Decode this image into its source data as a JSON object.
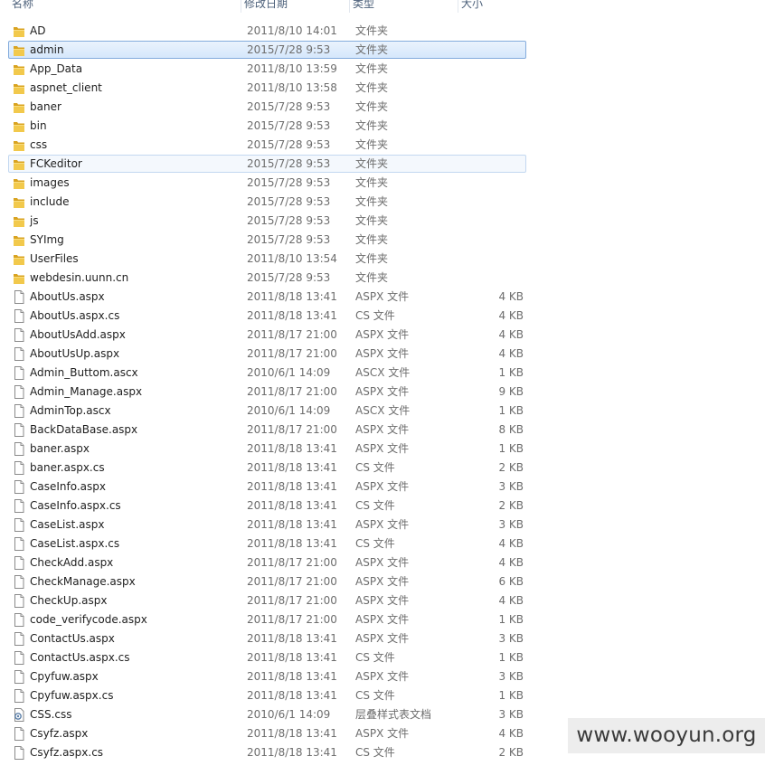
{
  "columns": {
    "name": "名称",
    "date": "修改日期",
    "type": "类型",
    "size": "大小"
  },
  "files": [
    {
      "name": "AD",
      "date": "2011/8/10 14:01",
      "type": "文件夹",
      "size": "",
      "icon": "folder-icon"
    },
    {
      "name": "admin",
      "date": "2015/7/28 9:53",
      "type": "文件夹",
      "size": "",
      "icon": "folder-icon",
      "state": "selected"
    },
    {
      "name": "App_Data",
      "date": "2011/8/10 13:59",
      "type": "文件夹",
      "size": "",
      "icon": "folder-icon"
    },
    {
      "name": "aspnet_client",
      "date": "2011/8/10 13:58",
      "type": "文件夹",
      "size": "",
      "icon": "folder-icon"
    },
    {
      "name": "baner",
      "date": "2015/7/28 9:53",
      "type": "文件夹",
      "size": "",
      "icon": "folder-icon"
    },
    {
      "name": "bin",
      "date": "2015/7/28 9:53",
      "type": "文件夹",
      "size": "",
      "icon": "folder-icon"
    },
    {
      "name": "css",
      "date": "2015/7/28 9:53",
      "type": "文件夹",
      "size": "",
      "icon": "folder-icon"
    },
    {
      "name": "FCKeditor",
      "date": "2015/7/28 9:53",
      "type": "文件夹",
      "size": "",
      "icon": "folder-icon",
      "state": "hover"
    },
    {
      "name": "images",
      "date": "2015/7/28 9:53",
      "type": "文件夹",
      "size": "",
      "icon": "folder-icon"
    },
    {
      "name": "include",
      "date": "2015/7/28 9:53",
      "type": "文件夹",
      "size": "",
      "icon": "folder-icon"
    },
    {
      "name": "js",
      "date": "2015/7/28 9:53",
      "type": "文件夹",
      "size": "",
      "icon": "folder-icon"
    },
    {
      "name": "SYImg",
      "date": "2015/7/28 9:53",
      "type": "文件夹",
      "size": "",
      "icon": "folder-icon"
    },
    {
      "name": "UserFiles",
      "date": "2011/8/10 13:54",
      "type": "文件夹",
      "size": "",
      "icon": "folder-icon"
    },
    {
      "name": "webdesin.uunn.cn",
      "date": "2015/7/28 9:53",
      "type": "文件夹",
      "size": "",
      "icon": "folder-icon"
    },
    {
      "name": "AboutUs.aspx",
      "date": "2011/8/18 13:41",
      "type": "ASPX 文件",
      "size": "4 KB",
      "icon": "file-icon"
    },
    {
      "name": "AboutUs.aspx.cs",
      "date": "2011/8/18 13:41",
      "type": "CS 文件",
      "size": "4 KB",
      "icon": "file-icon"
    },
    {
      "name": "AboutUsAdd.aspx",
      "date": "2011/8/17 21:00",
      "type": "ASPX 文件",
      "size": "4 KB",
      "icon": "file-icon"
    },
    {
      "name": "AboutUsUp.aspx",
      "date": "2011/8/17 21:00",
      "type": "ASPX 文件",
      "size": "4 KB",
      "icon": "file-icon"
    },
    {
      "name": "Admin_Buttom.ascx",
      "date": "2010/6/1 14:09",
      "type": "ASCX 文件",
      "size": "1 KB",
      "icon": "file-icon"
    },
    {
      "name": "Admin_Manage.aspx",
      "date": "2011/8/17 21:00",
      "type": "ASPX 文件",
      "size": "9 KB",
      "icon": "file-icon"
    },
    {
      "name": "AdminTop.ascx",
      "date": "2010/6/1 14:09",
      "type": "ASCX 文件",
      "size": "1 KB",
      "icon": "file-icon"
    },
    {
      "name": "BackDataBase.aspx",
      "date": "2011/8/17 21:00",
      "type": "ASPX 文件",
      "size": "8 KB",
      "icon": "file-icon"
    },
    {
      "name": "baner.aspx",
      "date": "2011/8/18 13:41",
      "type": "ASPX 文件",
      "size": "1 KB",
      "icon": "file-icon"
    },
    {
      "name": "baner.aspx.cs",
      "date": "2011/8/18 13:41",
      "type": "CS 文件",
      "size": "2 KB",
      "icon": "file-icon"
    },
    {
      "name": "CaseInfo.aspx",
      "date": "2011/8/18 13:41",
      "type": "ASPX 文件",
      "size": "3 KB",
      "icon": "file-icon"
    },
    {
      "name": "CaseInfo.aspx.cs",
      "date": "2011/8/18 13:41",
      "type": "CS 文件",
      "size": "2 KB",
      "icon": "file-icon"
    },
    {
      "name": "CaseList.aspx",
      "date": "2011/8/18 13:41",
      "type": "ASPX 文件",
      "size": "3 KB",
      "icon": "file-icon"
    },
    {
      "name": "CaseList.aspx.cs",
      "date": "2011/8/18 13:41",
      "type": "CS 文件",
      "size": "4 KB",
      "icon": "file-icon"
    },
    {
      "name": "CheckAdd.aspx",
      "date": "2011/8/17 21:00",
      "type": "ASPX 文件",
      "size": "4 KB",
      "icon": "file-icon"
    },
    {
      "name": "CheckManage.aspx",
      "date": "2011/8/17 21:00",
      "type": "ASPX 文件",
      "size": "6 KB",
      "icon": "file-icon"
    },
    {
      "name": "CheckUp.aspx",
      "date": "2011/8/17 21:00",
      "type": "ASPX 文件",
      "size": "4 KB",
      "icon": "file-icon"
    },
    {
      "name": "code_verifycode.aspx",
      "date": "2011/8/17 21:00",
      "type": "ASPX 文件",
      "size": "1 KB",
      "icon": "file-icon"
    },
    {
      "name": "ContactUs.aspx",
      "date": "2011/8/18 13:41",
      "type": "ASPX 文件",
      "size": "3 KB",
      "icon": "file-icon"
    },
    {
      "name": "ContactUs.aspx.cs",
      "date": "2011/8/18 13:41",
      "type": "CS 文件",
      "size": "1 KB",
      "icon": "file-icon"
    },
    {
      "name": "Cpyfuw.aspx",
      "date": "2011/8/18 13:41",
      "type": "ASPX 文件",
      "size": "3 KB",
      "icon": "file-icon"
    },
    {
      "name": "Cpyfuw.aspx.cs",
      "date": "2011/8/18 13:41",
      "type": "CS 文件",
      "size": "1 KB",
      "icon": "file-icon"
    },
    {
      "name": "CSS.css",
      "date": "2010/6/1 14:09",
      "type": "层叠样式表文档",
      "size": "3 KB",
      "icon": "css-file-icon"
    },
    {
      "name": "Csyfz.aspx",
      "date": "2011/8/18 13:41",
      "type": "ASPX 文件",
      "size": "4 KB",
      "icon": "file-icon"
    },
    {
      "name": "Csyfz.aspx.cs",
      "date": "2011/8/18 13:41",
      "type": "CS 文件",
      "size": "2 KB",
      "icon": "file-icon"
    }
  ],
  "watermark": "www.wooyun.org",
  "colors": {
    "selection_border": "#84acdd",
    "selection_fill": "#d5e7fb",
    "folder": "#e8b630"
  }
}
